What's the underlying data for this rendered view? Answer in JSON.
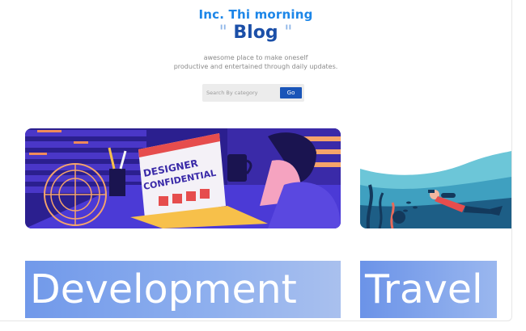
{
  "header": {
    "brand": "Inc. Thi morning",
    "title_open_quote": "\"",
    "title": "Blog",
    "title_close_quote": "\"",
    "tagline_line1": "awesome place to make oneself",
    "tagline_line2": "productive and entertained through daily updates."
  },
  "search": {
    "placeholder": "Search By category",
    "button_label": "Go"
  },
  "cards": [
    {
      "category": "Development",
      "image_icon": "designer-confidential-illustration",
      "image_text_line1": "DESIGNER",
      "image_text_line2": "CONFIDENTIAL"
    },
    {
      "category": "Travel",
      "image_icon": "scuba-diver-illustration"
    }
  ],
  "colors": {
    "brand": "#1c86e8",
    "title": "#1b4fa8",
    "button": "#1a55b8"
  }
}
